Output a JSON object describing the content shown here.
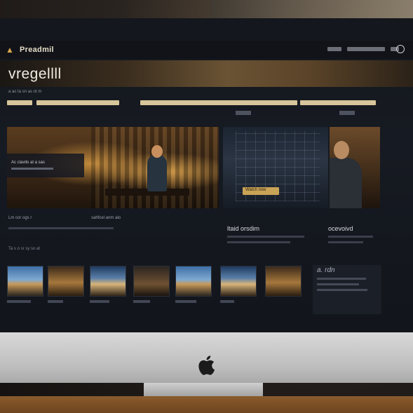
{
  "app": {
    "brand": "Preadmil",
    "hero_title": "vregellll",
    "subtitle": "a ac ta sn as ot m",
    "nav": [
      "menu",
      "search",
      "account"
    ]
  },
  "filters": [
    {
      "label": ""
    },
    {
      "label": ""
    },
    {
      "label": ""
    },
    {
      "label": ""
    }
  ],
  "featured": {
    "overlay_label": "Ac clavilo at a sas",
    "play_label": "Watch now"
  },
  "captions": {
    "left1": "Lm cor ogs r",
    "left2": "sahfcel anm alo",
    "right_title1": "ltaid orsdim",
    "right_title2": "ocevoivd"
  },
  "section": {
    "label": "Ta s o sr sy so at"
  },
  "side_panel": {
    "title": "a. rdn"
  },
  "thumbnails": [
    {
      "style": "sky"
    },
    {
      "style": "warm"
    },
    {
      "style": "dusk"
    },
    {
      "style": "interior"
    },
    {
      "style": "sky"
    },
    {
      "style": "dusk"
    },
    {
      "style": "warm"
    }
  ],
  "colors": {
    "accent_gold": "#d8c69a",
    "background": "#14171d"
  }
}
